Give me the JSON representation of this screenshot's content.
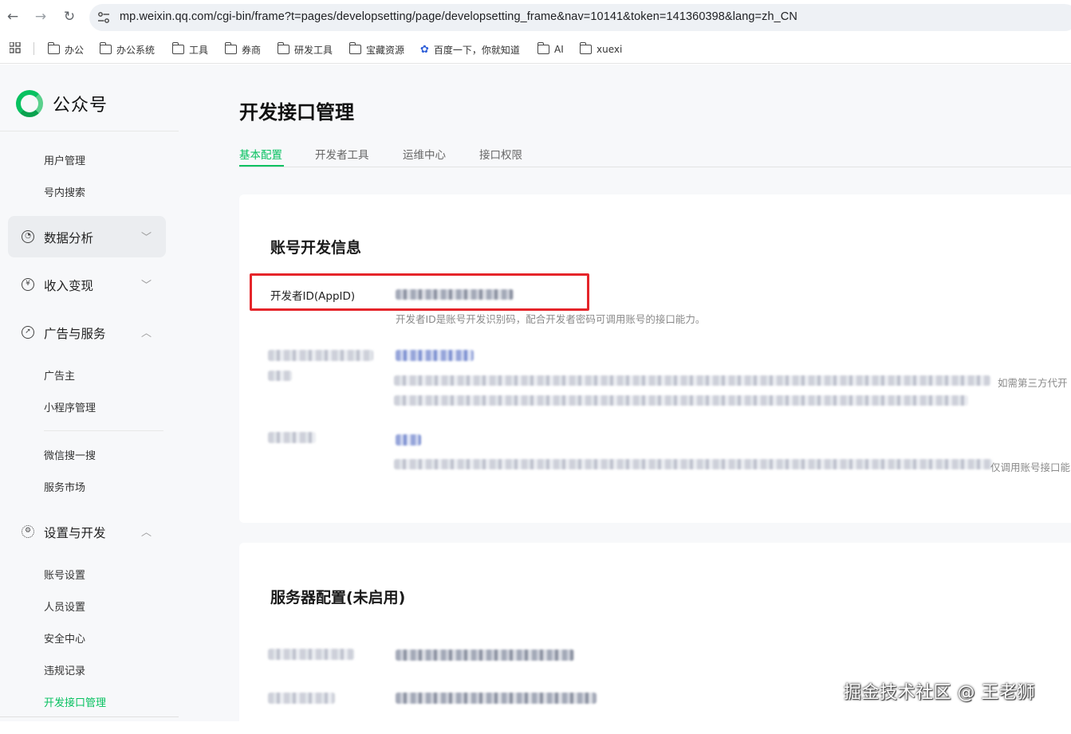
{
  "browser": {
    "url": "mp.weixin.qq.com/cgi-bin/frame?t=pages/developsetting/page/developsetting_frame&nav=10141&token=141360398&lang=zh_CN",
    "back_icon": "arrow-left-icon",
    "forward_icon": "arrow-right-icon",
    "reload_icon": "reload-icon",
    "bookmarks": [
      {
        "label": "办公",
        "icon": "folder-icon"
      },
      {
        "label": "办公系统",
        "icon": "folder-icon"
      },
      {
        "label": "工具",
        "icon": "folder-icon"
      },
      {
        "label": "券商",
        "icon": "folder-icon"
      },
      {
        "label": "研发工具",
        "icon": "folder-icon"
      },
      {
        "label": "宝藏资源",
        "icon": "folder-icon"
      },
      {
        "label": "百度一下，你就知道",
        "icon": "baidu-paw-icon"
      },
      {
        "label": "AI",
        "icon": "folder-icon"
      },
      {
        "label": "xuexi",
        "icon": "folder-icon"
      }
    ]
  },
  "sidebar": {
    "brand": "公众号",
    "items": {
      "user_mgmt": "用户管理",
      "in_search": "号内搜索",
      "analytics": "数据分析",
      "revenue": "收入变现",
      "ads": "广告与服务",
      "advertiser": "广告主",
      "miniprogram": "小程序管理",
      "wechat_search": "微信搜一搜",
      "service_market": "服务市场",
      "settings": "设置与开发",
      "account": "账号设置",
      "staff": "人员设置",
      "security": "安全中心",
      "violations": "违规记录",
      "dev_api": "开发接口管理"
    }
  },
  "main": {
    "title": "开发接口管理",
    "tabs": [
      "基本配置",
      "开发者工具",
      "运维中心",
      "接口权限"
    ],
    "account_info": {
      "title": "账号开发信息",
      "appid_label": "开发者ID(AppID)",
      "appid_hint": "开发者ID是账号开发识别码，配合开发者密码可调用账号的接口能力。",
      "edge_text_1": "如需第三方代开",
      "edge_text_2": "仅调用账号接口能"
    },
    "server_config": {
      "title": "服务器配置(未启用)"
    }
  },
  "watermark": "掘金技术社区 @ 王老狮",
  "colors": {
    "accent": "#07c160",
    "highlight_box": "#e5252a"
  }
}
